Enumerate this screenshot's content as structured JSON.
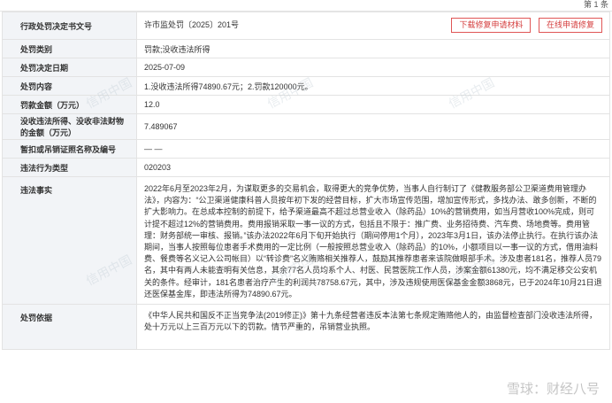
{
  "page_indicator": "第 1 条",
  "rows": [
    {
      "label": "行政处罚决定书文号",
      "value": "许市监处罚〔2025〕201号"
    },
    {
      "label": "处罚类别",
      "value": "罚款;没收违法所得"
    },
    {
      "label": "处罚决定日期",
      "value": "2025-07-09"
    },
    {
      "label": "处罚内容",
      "value": "1.没收违法所得74890.67元；2.罚款120000元。"
    },
    {
      "label": "罚款金额（万元）",
      "value": "12.0"
    },
    {
      "label": "没收违法所得、没收非法财物的金额（万元）",
      "value": "7.489067"
    },
    {
      "label": "暂扣或吊销证照名称及编号",
      "value": "— —"
    },
    {
      "label": "违法行为类型",
      "value": "020203"
    },
    {
      "label": "违法事实",
      "value": "2022年6月至2023年2月，为谋取更多的交易机会，取得更大的竞争优势，当事人自行制订了《健教服务部公卫渠道费用管理办法》，内容为：“公卫渠道健康科普人员按年初下发的经营目标，扩大市场宣传范围，增加宣传形式，多找办法、敢多创新，不断的扩大影响力。在总成本控制的前提下，给予渠道最高不超过总营业收入（除药品）10%的营销费用，如当月营收100%完成，则可计提不超过12%的营销费用。费用报销采取一事一议的方式，包括且不限于：推广费、业务招待费、汽车费、场地费等。费用管理：财务部统一审核、报销。”该办法2022年6月下旬开始执行（期间停用1个月），2023年3月1日，该办法停止执行。在执行该办法期间，当事人按照每位患者手术费用的一定比例（一般按照总营业收入（除药品）的10%，小额项目以一事一议的方式，借用油料费、餐费等名义记入公司帐目）以“转诊费”名义贿赂相关推荐人，鼓励其推荐患者来该院做眼部手术。涉及患者181名，推荐人员79名，其中有两人未能查明有关信息，其余77名人员均系个人、村医、民营医院工作人员，涉案金额61380元，均不满足移交公安机关的条件。经审计，181名患者治疗产生的利润共78758.67元，其中，涉及违规使用医保基金金额3868元，已于2024年10月21日退还医保基金库，即违法所得为74890.67元。"
    },
    {
      "label": "处罚依据",
      "value": "《中华人民共和国反不正当竞争法(2019修正)》第十九条经营者违反本法第七条规定贿赂他人的，由监督检查部门没收违法所得，处十万元以上三百万元以下的罚款。情节严重的，吊销营业执照。"
    }
  ],
  "buttons": {
    "download": "下载修复申请材料",
    "online": "在线申请修复"
  },
  "watermark": "雪球：财经八号",
  "bg_watermark": "信用中国"
}
